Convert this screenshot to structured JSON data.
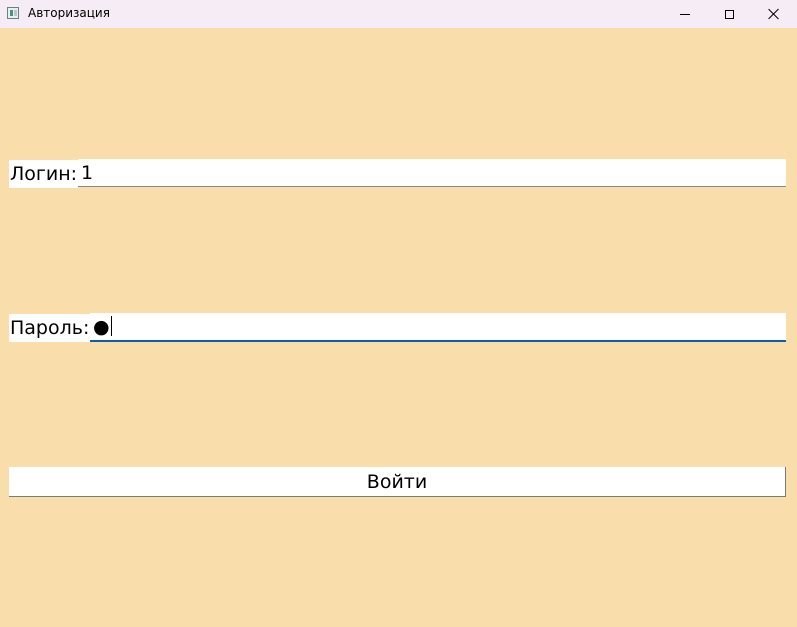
{
  "window": {
    "title": "Авторизация",
    "icon": "app-window-icon",
    "controls": {
      "minimize": "minimize-icon",
      "maximize": "maximize-icon",
      "close": "close-icon"
    },
    "background_color": "#f9deab"
  },
  "form": {
    "login_label": "Логин:",
    "login_value": "1",
    "password_label": "Пароль:",
    "password_value": "●",
    "submit_label": "Войти"
  },
  "colors": {
    "focus_underline": "#0a5fb4",
    "field_background": "#ffffff"
  }
}
